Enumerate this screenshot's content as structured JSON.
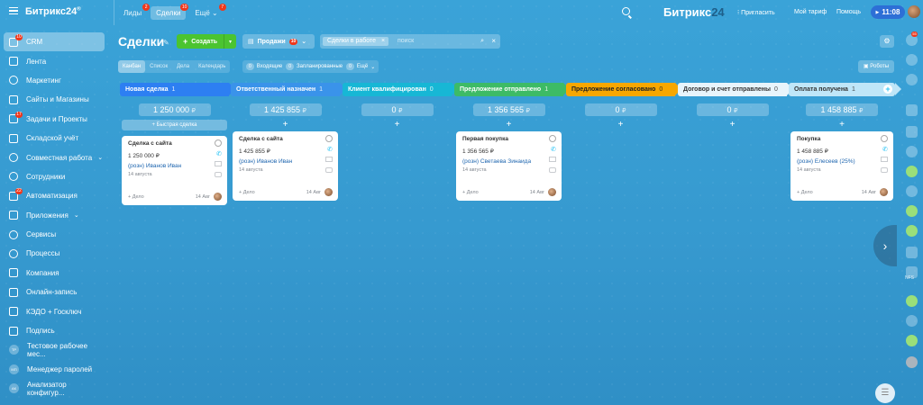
{
  "header": {
    "logo": "Битрикс24",
    "logo_mark": "®",
    "tabs": [
      {
        "label": "Лиды",
        "badge": "2"
      },
      {
        "label": "Сделки",
        "badge": "10"
      },
      {
        "label": "Ещё",
        "badge": "7"
      }
    ],
    "brand_main": "Битрикс",
    "brand_num": "24",
    "invite": "Пригласить",
    "tariff": "Мой тариф",
    "help": "Помощь",
    "time": "11:08"
  },
  "sidebar": {
    "items": [
      {
        "label": "CRM",
        "badge": "10"
      },
      {
        "label": "Лента",
        "badge": ""
      },
      {
        "label": "Маркетинг",
        "badge": ""
      },
      {
        "label": "Сайты и Магазины",
        "badge": ""
      },
      {
        "label": "Задачи и Проекты",
        "badge": "17"
      },
      {
        "label": "Складской учёт",
        "badge": ""
      },
      {
        "label": "Совместная работа",
        "badge": ""
      },
      {
        "label": "Сотрудники",
        "badge": ""
      },
      {
        "label": "Автоматизация",
        "badge": "22"
      },
      {
        "label": "Приложения",
        "badge": ""
      },
      {
        "label": "Сервисы",
        "badge": ""
      },
      {
        "label": "Процессы",
        "badge": ""
      },
      {
        "label": "Компания",
        "badge": ""
      },
      {
        "label": "Онлайн-запись",
        "badge": ""
      },
      {
        "label": "КЭДО + Госключ",
        "badge": ""
      },
      {
        "label": "Подпись",
        "badge": ""
      },
      {
        "label": "Тестовое рабочее мес...",
        "badge": "",
        "avatar": "ТР"
      },
      {
        "label": "Менеджер паролей",
        "badge": "",
        "avatar": "МП"
      },
      {
        "label": "Анализатор конфигур...",
        "badge": "",
        "avatar": "АК"
      }
    ]
  },
  "toolbar": {
    "title": "Сделки",
    "create_label": "Создать",
    "funnel_label": "Продажи",
    "funnel_badge": "10",
    "filter_chip": "Сделки в работе",
    "search_placeholder": "поиск",
    "robots_label": "Роботы"
  },
  "views": {
    "tabs": [
      "Канбан",
      "Список",
      "Дела",
      "Календарь"
    ],
    "counters": [
      {
        "num": "0",
        "label": "Входящие"
      },
      {
        "num": "0",
        "label": "Запланированные"
      },
      {
        "num": "0",
        "label": "Ещё"
      }
    ]
  },
  "colors": {
    "stage1": "#2d7ff2",
    "stage2": "#3a93ea",
    "stage3": "#17b7d5",
    "stage4": "#3dbb66",
    "stage5": "#f7a700",
    "stage6": "#4d9ed8",
    "stage7": "#b2e1f7"
  },
  "columns": [
    {
      "title": "Новая сделка",
      "count": "1",
      "sum": "1 250 000",
      "currency": "₽",
      "quick": "Быстрая сделка",
      "card": {
        "title": "Сделка с сайта",
        "amount": "1 250 000 ₽",
        "client": "(розн) Иванов Иван",
        "date": "14 августа",
        "task": "+ Дело",
        "foot_date": "14 Авг"
      }
    },
    {
      "title": "Ответственный назначен",
      "count": "1",
      "sum": "1 425 855",
      "currency": "₽",
      "card": {
        "title": "Сделка с сайта",
        "amount": "1 425 855 ₽",
        "client": "(розн) Иванов Иван",
        "date": "14 августа",
        "task": "+ Дело",
        "foot_date": "14 Авг"
      }
    },
    {
      "title": "Клиент квалифицирован",
      "count": "0",
      "sum": "0",
      "currency": "₽"
    },
    {
      "title": "Предложение отправлено",
      "count": "1",
      "sum": "1 356 565",
      "currency": "₽",
      "card": {
        "title": "Первая покупка",
        "amount": "1 356 565 ₽",
        "client": "(розн) Светаева Зинаида",
        "date": "14 августа",
        "task": "+ Дело",
        "foot_date": "14 Авг"
      }
    },
    {
      "title": "Предложение согласовано",
      "count": "0",
      "sum": "0",
      "currency": "₽"
    },
    {
      "title": "Договор и счет отправлены",
      "count": "0",
      "sum": "0",
      "currency": "₽"
    },
    {
      "title": "Оплата получена",
      "count": "1",
      "sum": "1 458 885",
      "currency": "₽",
      "card": {
        "title": "Покупка",
        "amount": "1 458 885 ₽",
        "client": "(розн) Елесеев (25%)",
        "date": "14 августа",
        "task": "+ Дело",
        "foot_date": "14 Авг"
      }
    }
  ],
  "rail": {
    "top_badge": "55",
    "ai_label": "NFS"
  }
}
